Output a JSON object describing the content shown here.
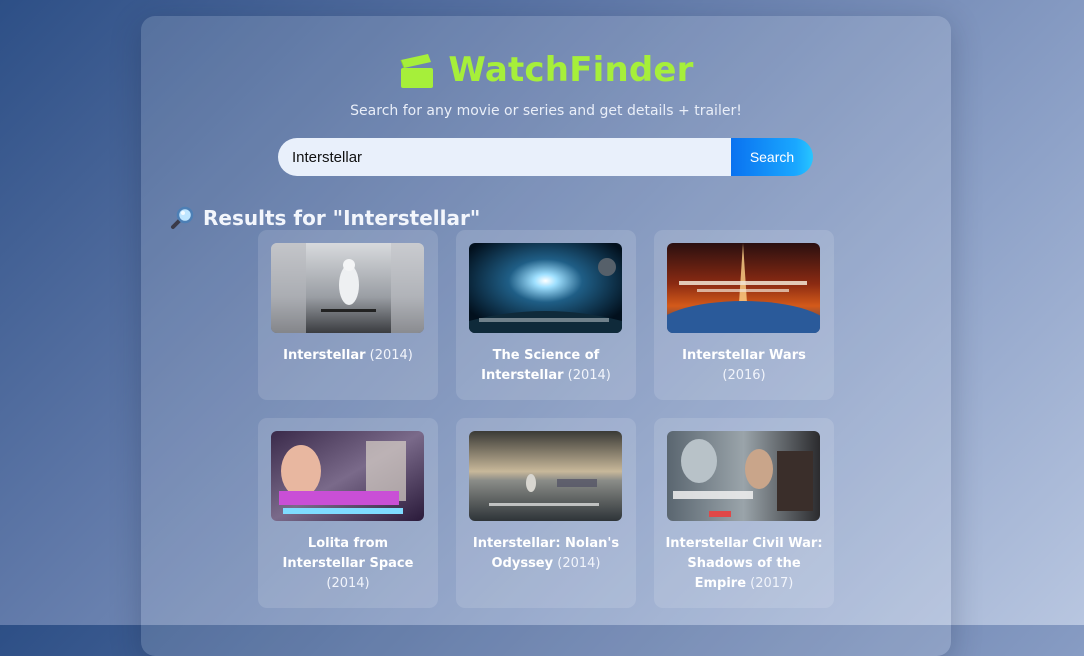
{
  "brand": {
    "title": "WatchFinder",
    "icon": "clapperboard-icon",
    "color": "#a6ef3a"
  },
  "tagline": "Search for any movie or series and get details + trailer!",
  "search": {
    "value": "Interstellar",
    "button_label": "Search"
  },
  "results": {
    "heading": "Results for \"Interstellar\"",
    "icon": "magnifier-icon",
    "items": [
      {
        "title": "Interstellar",
        "year": "(2014)"
      },
      {
        "title": "The Science of Interstellar",
        "year": "(2014)"
      },
      {
        "title": "Interstellar Wars",
        "year": "(2016)"
      },
      {
        "title": "Lolita from Interstellar Space",
        "year": "(2014)"
      },
      {
        "title": "Interstellar: Nolan's Odyssey",
        "year": "(2014)"
      },
      {
        "title": "Interstellar Civil War: Shadows of the Empire",
        "year": "(2017)"
      }
    ]
  }
}
